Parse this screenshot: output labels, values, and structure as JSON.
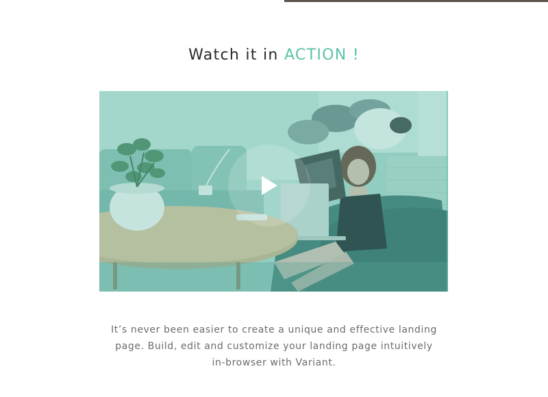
{
  "section": {
    "heading_prefix": "Watch it in ",
    "heading_accent": "ACTION !",
    "description_lines": [
      "It’s never been easier to create a unique and effective landing",
      "page. Build, edit and customize your landing page intuitively",
      "in-browser with Variant."
    ]
  },
  "video": {
    "play_icon": "play-icon"
  },
  "colors": {
    "accent": "#5bc2a7",
    "heading": "#2a2a2a",
    "body_text": "#6b6b6b",
    "video_tint": "#6aa79c"
  }
}
